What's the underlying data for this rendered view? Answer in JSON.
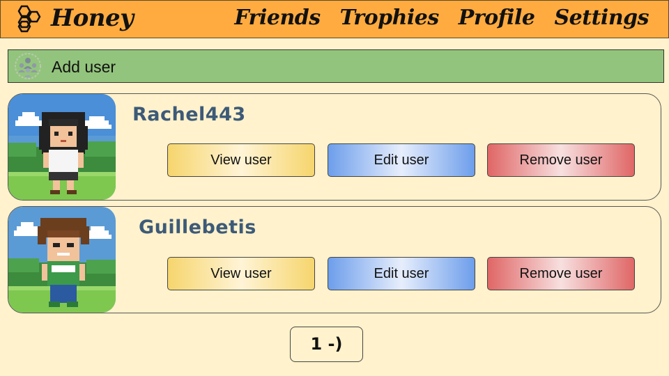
{
  "app": {
    "brand": "Honey"
  },
  "nav": {
    "items": [
      "Friends",
      "Trophies",
      "Profile",
      "Settings"
    ]
  },
  "add_user": {
    "label": "Add user",
    "icon": "group-icon"
  },
  "users": [
    {
      "name": "Rachel443",
      "view_label": "View user",
      "edit_label": "Edit user",
      "remove_label": "Remove user"
    },
    {
      "name": "Guillebetis",
      "view_label": "View user",
      "edit_label": "Edit user",
      "remove_label": "Remove user"
    }
  ],
  "pagination": {
    "label": "1 -)"
  },
  "colors": {
    "topbar": "#ffab40",
    "background": "#fff2cc",
    "add_user_bar": "#93c47d",
    "username": "#3d5a78",
    "view_button": "#f6d56d",
    "edit_button": "#6d9eeb",
    "remove_button": "#e06666"
  }
}
